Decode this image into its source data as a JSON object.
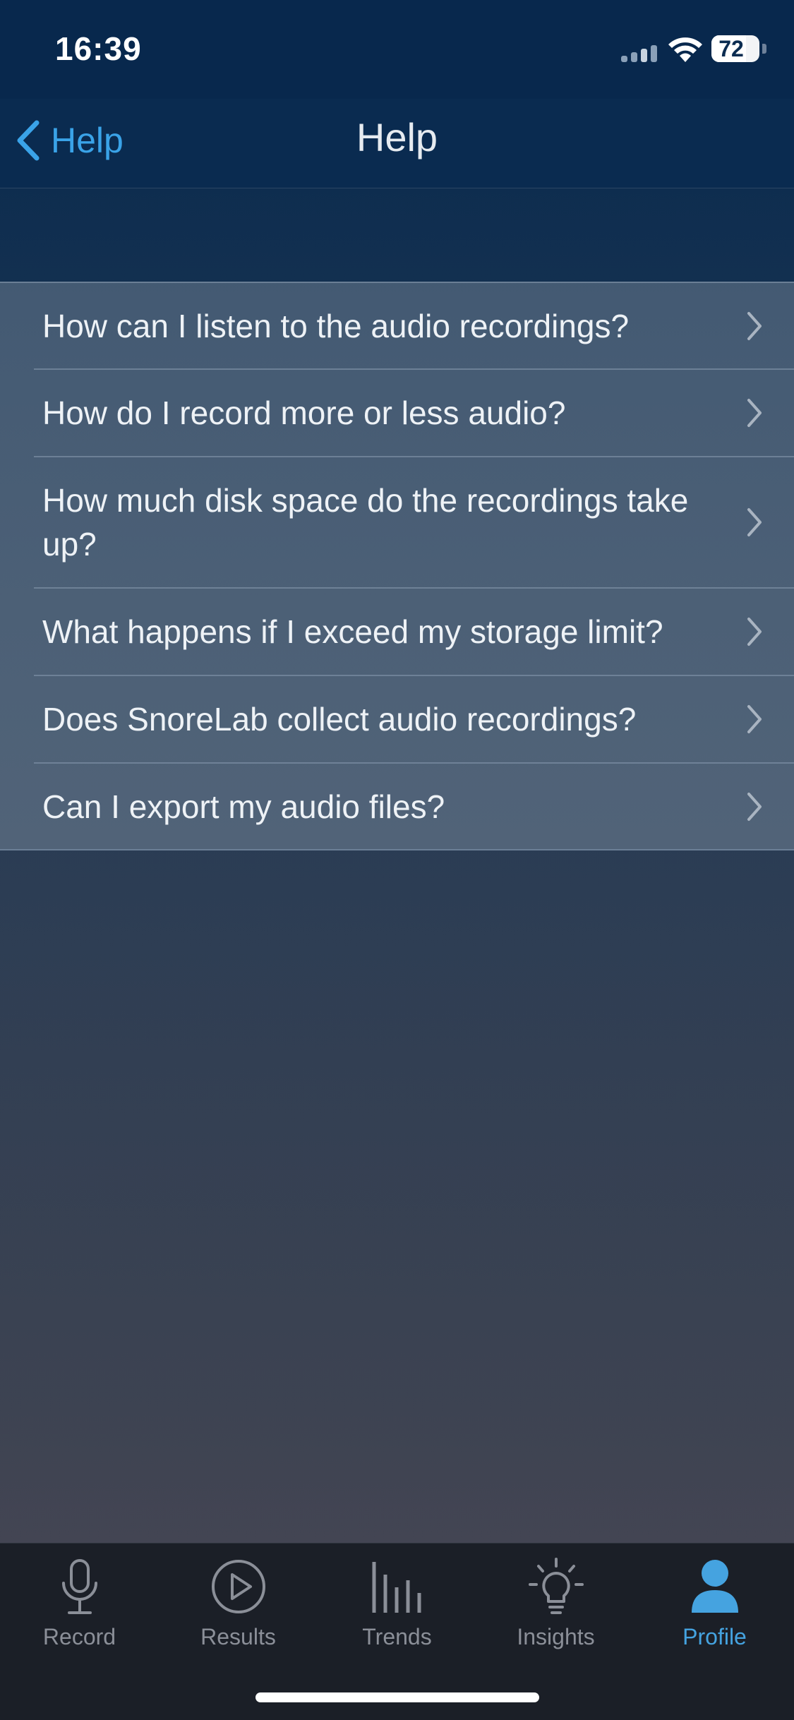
{
  "status": {
    "time": "16:39",
    "battery": "72",
    "battery_level": 0.72
  },
  "nav": {
    "back_label": "Help",
    "title": "Help"
  },
  "faq": [
    {
      "question": "How can I listen to the audio recordings?"
    },
    {
      "question": "How do I record more or less audio?"
    },
    {
      "question": "How much disk space do the recordings take up?"
    },
    {
      "question": "What happens if I exceed my storage limit?"
    },
    {
      "question": "Does SnoreLab collect audio recordings?"
    },
    {
      "question": "Can I export my audio files?"
    }
  ],
  "tabs": [
    {
      "label": "Record",
      "icon": "microphone-icon"
    },
    {
      "label": "Results",
      "icon": "play-circle-icon"
    },
    {
      "label": "Trends",
      "icon": "bars-icon"
    },
    {
      "label": "Insights",
      "icon": "lightbulb-icon"
    },
    {
      "label": "Profile",
      "icon": "person-icon",
      "active": true
    }
  ],
  "colors": {
    "accent": "#45a3e0",
    "back_link": "#3aa3e8",
    "inactive_tab": "#8b8f98",
    "nav_background": "#0a2b50"
  }
}
